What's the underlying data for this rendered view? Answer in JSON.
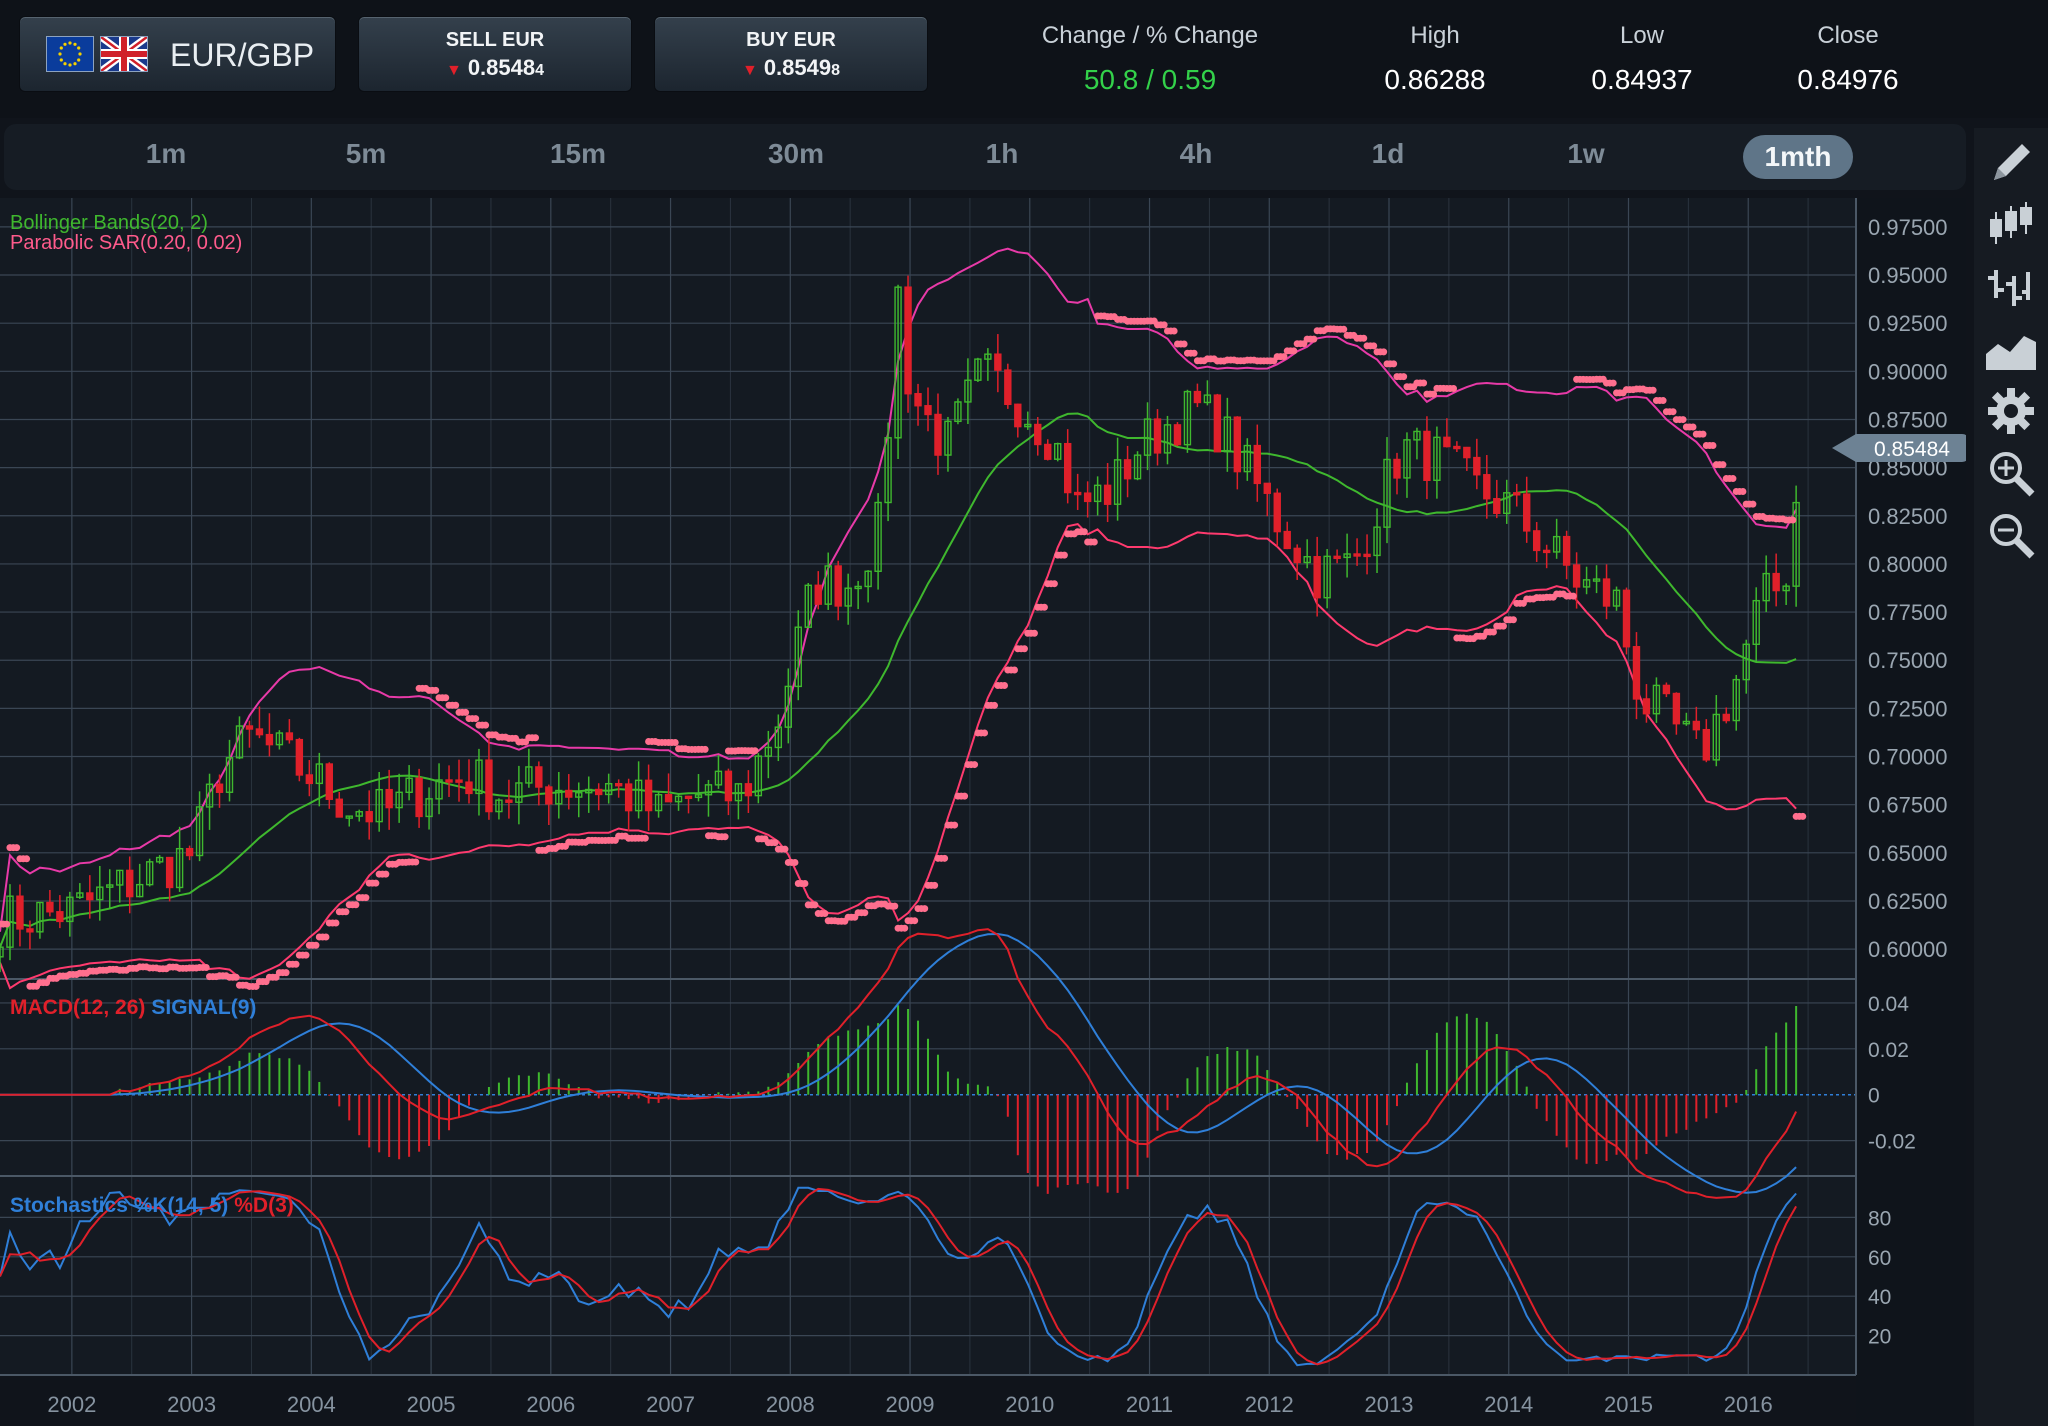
{
  "instrument": {
    "name": "EUR/GBP",
    "flags": [
      "eu-flag-icon",
      "uk-flag-icon"
    ]
  },
  "sell": {
    "label": "SELL EUR",
    "price_main": "0.8548",
    "price_small": "4"
  },
  "buy": {
    "label": "BUY EUR",
    "price_main": "0.8549",
    "price_small": "8"
  },
  "stats": [
    {
      "key": "change",
      "label": "Change / % Change",
      "value": "50.8 / 0.59"
    },
    {
      "key": "high",
      "label": "High",
      "value": "0.86288"
    },
    {
      "key": "low",
      "label": "Low",
      "value": "0.84937"
    },
    {
      "key": "close",
      "label": "Close",
      "value": "0.84976"
    }
  ],
  "timeframes": [
    "1m",
    "5m",
    "15m",
    "30m",
    "1h",
    "4h",
    "1d",
    "1w",
    "1mth"
  ],
  "active_timeframe": "1mth",
  "toolbar": [
    "pencil-icon",
    "candlestick-icon",
    "ohlc-bars-icon",
    "area-chart-icon",
    "gear-icon",
    "zoom-in-icon",
    "zoom-out-icon"
  ],
  "colors": {
    "up": "#3fb82e",
    "down": "#e0202a",
    "bollinger": "#e83aa8",
    "sar": "#ff6f8e",
    "ma": "#3fb82e",
    "macd": "#e0202a",
    "signal": "#2f7fd8",
    "positive_text": "#33d14a"
  },
  "chart_data": {
    "type": "candlestick",
    "indicator_labels": {
      "bollinger": "Bollinger Bands(20, 2)",
      "sar": "Parabolic SAR(0.20, 0.02)"
    },
    "price_axis": {
      "ticks": [
        "0.97500",
        "0.95000",
        "0.92500",
        "0.90000",
        "0.87500",
        "0.85000",
        "0.82500",
        "0.80000",
        "0.77500",
        "0.75000",
        "0.72500",
        "0.70000",
        "0.67500",
        "0.65000",
        "0.62500",
        "0.60000"
      ],
      "ylim": [
        0.585,
        0.99
      ]
    },
    "current_price": "0.85484",
    "x_labels": [
      "2002",
      "2003",
      "2004",
      "2005",
      "2006",
      "2007",
      "2008",
      "2009",
      "2010",
      "2011",
      "2012",
      "2013",
      "2014",
      "2015",
      "2016"
    ],
    "x_range": [
      2001.4,
      2016.9
    ],
    "close_series": [
      [
        2001.4,
        0.615
      ],
      [
        2002.0,
        0.62
      ],
      [
        2002.5,
        0.635
      ],
      [
        2003.0,
        0.65
      ],
      [
        2003.25,
        0.695
      ],
      [
        2003.5,
        0.71
      ],
      [
        2004.0,
        0.69
      ],
      [
        2004.3,
        0.675
      ],
      [
        2004.6,
        0.67
      ],
      [
        2005.0,
        0.685
      ],
      [
        2005.3,
        0.69
      ],
      [
        2005.6,
        0.68
      ],
      [
        2006.0,
        0.685
      ],
      [
        2006.5,
        0.685
      ],
      [
        2006.9,
        0.67
      ],
      [
        2007.2,
        0.68
      ],
      [
        2007.6,
        0.68
      ],
      [
        2007.9,
        0.72
      ],
      [
        2008.2,
        0.79
      ],
      [
        2008.5,
        0.79
      ],
      [
        2008.75,
        0.82
      ],
      [
        2008.9,
        0.94
      ],
      [
        2009.0,
        0.89
      ],
      [
        2009.3,
        0.86
      ],
      [
        2009.6,
        0.9
      ],
      [
        2009.9,
        0.885
      ],
      [
        2010.2,
        0.865
      ],
      [
        2010.4,
        0.83
      ],
      [
        2010.7,
        0.84
      ],
      [
        2010.9,
        0.86
      ],
      [
        2011.2,
        0.875
      ],
      [
        2011.4,
        0.88
      ],
      [
        2011.6,
        0.87
      ],
      [
        2011.9,
        0.84
      ],
      [
        2012.1,
        0.82
      ],
      [
        2012.4,
        0.795
      ],
      [
        2012.7,
        0.8
      ],
      [
        2012.9,
        0.83
      ],
      [
        2013.1,
        0.86
      ],
      [
        2013.4,
        0.855
      ],
      [
        2013.7,
        0.84
      ],
      [
        2014.0,
        0.83
      ],
      [
        2014.3,
        0.81
      ],
      [
        2014.6,
        0.79
      ],
      [
        2014.9,
        0.78
      ],
      [
        2015.1,
        0.73
      ],
      [
        2015.3,
        0.72
      ],
      [
        2015.6,
        0.7
      ],
      [
        2015.9,
        0.74
      ],
      [
        2016.1,
        0.78
      ],
      [
        2016.3,
        0.79
      ],
      [
        2016.45,
        0.855
      ]
    ],
    "macd_axis": {
      "ticks": [
        "0.04",
        "0.02",
        "0",
        "-0.02"
      ],
      "ylim": [
        -0.035,
        0.05
      ]
    },
    "macd_label": "MACD(12, 26)",
    "signal_label": "SIGNAL(9)",
    "stoch_axis": {
      "ticks": [
        "80",
        "60",
        "40",
        "20"
      ],
      "ylim": [
        0,
        100
      ]
    },
    "stoch_label_k": "Stochastics %K(14, 5)",
    "stoch_label_d": "%D(3)"
  }
}
